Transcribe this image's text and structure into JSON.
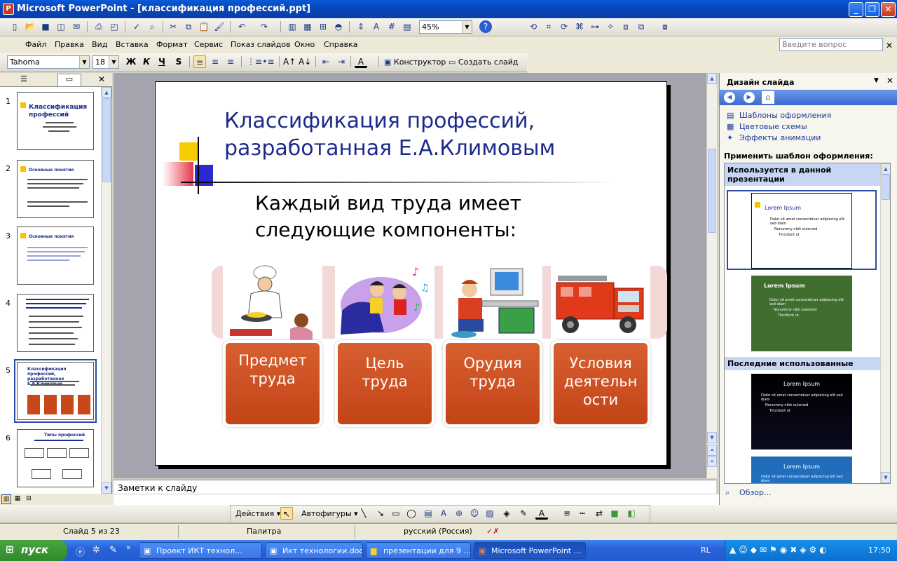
{
  "window": {
    "title": "Microsoft PowerPoint - [классификация профессий.ppt]"
  },
  "toolbar": {
    "zoom": "45%",
    "help": "?"
  },
  "menu": {
    "items": [
      "Файл",
      "Правка",
      "Вид",
      "Вставка",
      "Формат",
      "Сервис",
      "Показ слайдов",
      "Окно",
      "Справка"
    ],
    "ask_placeholder": "Введите вопрос"
  },
  "format_toolbar": {
    "font": "Tahoma",
    "size": "18",
    "bold": "Ж",
    "italic": "К",
    "underline": "Ч",
    "shadow": "S",
    "designer": "Конструктор",
    "new_slide": "Создать слайд"
  },
  "thumbnails": [
    {
      "num": "1",
      "title": "Классификация профессий"
    },
    {
      "num": "2",
      "title": "Основные понятия"
    },
    {
      "num": "3",
      "title": "Основные понятия"
    },
    {
      "num": "4",
      "title": ""
    },
    {
      "num": "5",
      "title": "Классификация профессий, разработанная Е.А.Климовым"
    },
    {
      "num": "6",
      "title": "Типы профессий"
    }
  ],
  "slide": {
    "title_line1": "Классификация профессий,",
    "title_line2": "разработанная Е.А.Климовым",
    "subtitle_line1": "Каждый вид труда имеет",
    "subtitle_line2": "следующие компоненты:",
    "cards": [
      {
        "line1": "Предмет",
        "line2": "труда",
        "line3": ""
      },
      {
        "line1": "Цель",
        "line2": "труда",
        "line3": ""
      },
      {
        "line1": "Орудия",
        "line2": "труда",
        "line3": ""
      },
      {
        "line1": "Условия",
        "line2": "деятельн",
        "line3": "ости"
      }
    ]
  },
  "notes": {
    "placeholder": "Заметки к слайду"
  },
  "taskpane": {
    "title": "Дизайн слайда",
    "links": [
      "Шаблоны оформления",
      "Цветовые схемы",
      "Эффекты анимации"
    ],
    "apply_label": "Применить шаблон оформления:",
    "section_used": "Используется в данной презентации",
    "section_recent": "Последние использованные",
    "browse": "Обзор...",
    "template_title": "Lorem Ipsum",
    "template_b1": "Dolor sit amet consectetuer adipiscing elit sed diam",
    "template_b2": "Nonummy nibh euismod",
    "template_b3": "Tincidunt ut"
  },
  "drawing": {
    "actions": "Действия",
    "autoshapes": "Автофигуры"
  },
  "status": {
    "slide": "Слайд 5 из 23",
    "design": "Палитра",
    "lang": "русский (Россия)"
  },
  "taskbar": {
    "start": "пуск",
    "buttons": [
      "Проект ИКТ технол...",
      "Икт технологии.doc...",
      "презентации для 9 ...",
      "Microsoft PowerPoint ..."
    ],
    "lang": "RL",
    "time": "17:50"
  },
  "colors": {
    "title_blue": "#1d2a8a",
    "card_orange": "#c9481a",
    "xp_blue": "#0a5ad8",
    "start_green": "#3a9a34"
  }
}
